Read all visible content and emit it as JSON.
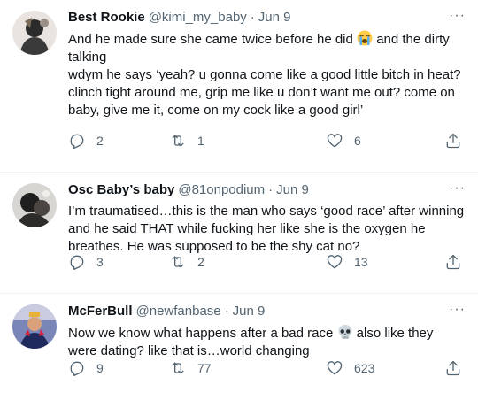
{
  "tweets": [
    {
      "name": "Best Rookie",
      "handle": "@kimi_my_baby",
      "sep": "·",
      "date": "Jun 9",
      "text_before_emoji": "And he made sure she came twice before he did ",
      "text_after_emoji": " and the dirty talking\nwdym he says ‘yeah? u gonna come like a good little bitch in heat? clinch tight around me, grip me like u don’t want me out? come on baby, give me it, come on my cock like a good girl’",
      "emoji": "loudly-crying-face",
      "replies": "2",
      "retweets": "1",
      "likes": "6"
    },
    {
      "name": "Osc Baby’s baby",
      "handle": "@81onpodium",
      "sep": "·",
      "date": "Jun 9",
      "text": "I’m traumatised…this is the man who says ‘good race’ after winning and he said THAT while fucking her like she is the oxygen he breathes. He was supposed to be the shy cat no?",
      "replies": "3",
      "retweets": "2",
      "likes": "13"
    },
    {
      "name": "McFerBull",
      "handle": "@newfanbase",
      "sep": "·",
      "date": "Jun 9",
      "text_before_emoji": "Now we know what happens after a bad race ",
      "text_after_emoji": " also like they were dating? like that is…world changing",
      "emoji": "skull",
      "replies": "9",
      "retweets": "77",
      "likes": "623"
    }
  ],
  "more_label": "···",
  "colors": {
    "text": "#0f1419",
    "secondary": "#536471",
    "divider": "#eff3f4"
  }
}
